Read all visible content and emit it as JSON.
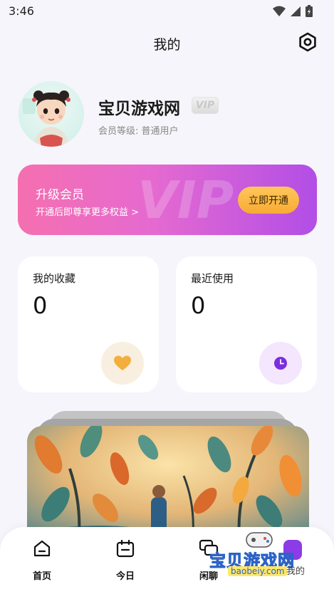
{
  "status_bar": {
    "time": "3:46"
  },
  "header": {
    "title": "我的"
  },
  "profile": {
    "username": "宝贝游戏网",
    "vip_tag": "VIP",
    "member_level": "会员等级: 普通用户"
  },
  "vip_banner": {
    "title": "升级会员",
    "subtitle": "开通后即尊享更多权益 >",
    "watermark": "VIP",
    "button": "立即开通"
  },
  "stats": {
    "favorites": {
      "label": "我的收藏",
      "value": "0"
    },
    "recent": {
      "label": "最近使用",
      "value": "0"
    }
  },
  "bottom_nav": {
    "items": [
      {
        "label": "首页",
        "icon": "home-icon"
      },
      {
        "label": "今日",
        "icon": "calendar-icon"
      },
      {
        "label": "闲聊",
        "icon": "chat-icon"
      }
    ]
  },
  "watermark": {
    "title": "宝贝游戏网",
    "url": "baobeiy.com",
    "overlap_label": "我的"
  },
  "colors": {
    "vip_gradient_start": "#f56fb0",
    "vip_gradient_end": "#b24ee6",
    "vip_button": "#f7ab33",
    "heart": "#f4ae3c",
    "clock": "#7b2ee0"
  }
}
